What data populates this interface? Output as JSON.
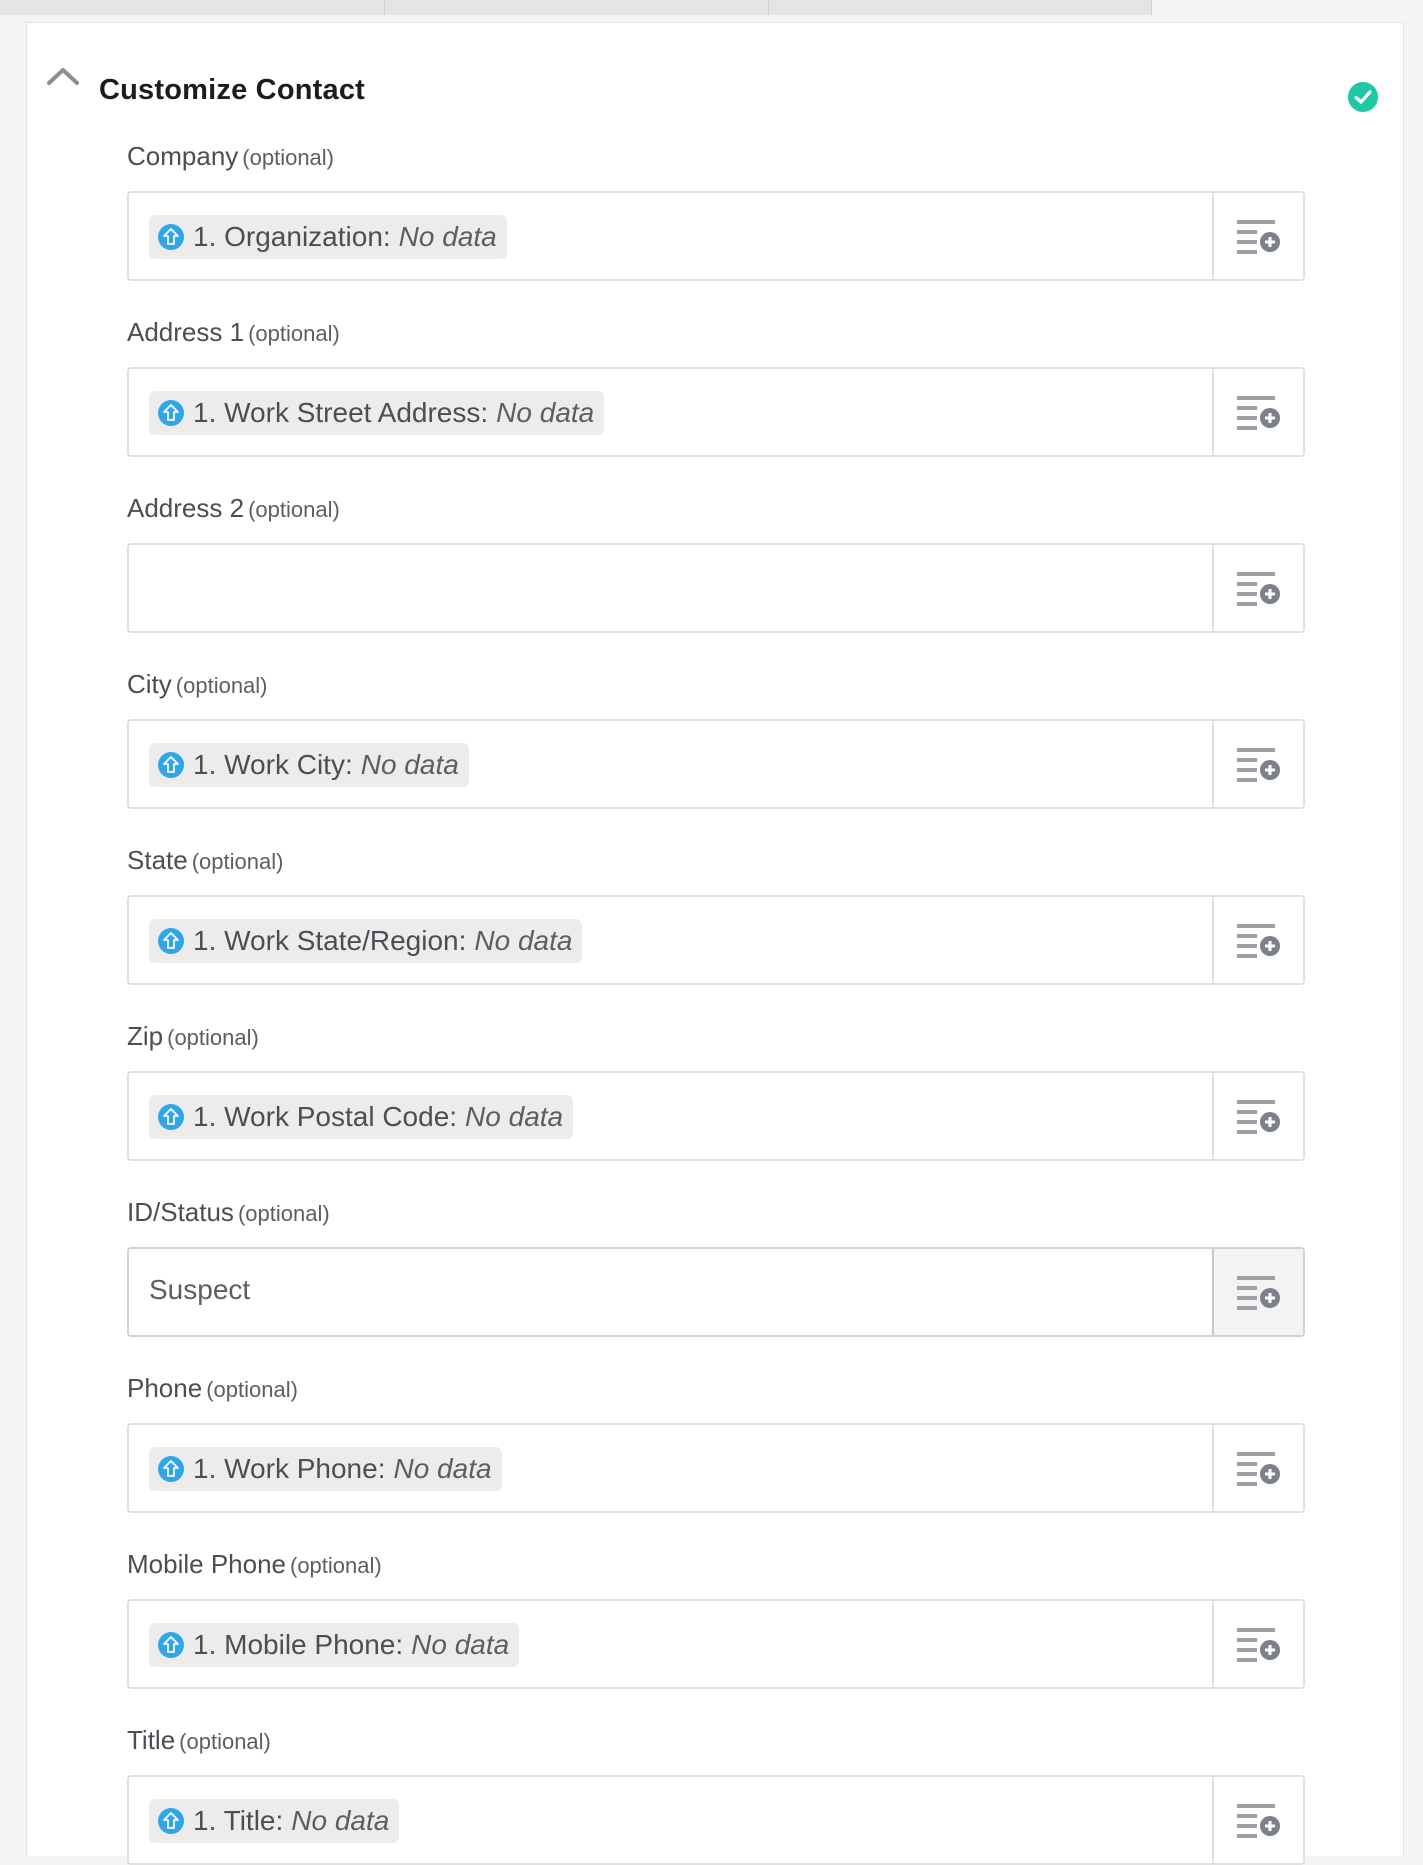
{
  "section": {
    "title": "Customize Contact",
    "status": "complete"
  },
  "colors": {
    "accent_check": "#1fc8a4",
    "pill_icon": "#2ea6e8"
  },
  "optional_marker": "(optional)",
  "fields": [
    {
      "label": "Company",
      "mapped_field": "1. Organization:",
      "mapped_value": "No data"
    },
    {
      "label": "Address 1",
      "mapped_field": "1. Work Street Address:",
      "mapped_value": "No data"
    },
    {
      "label": "Address 2",
      "value": ""
    },
    {
      "label": "City",
      "mapped_field": "1. Work City:",
      "mapped_value": "No data"
    },
    {
      "label": "State",
      "mapped_field": "1. Work State/Region:",
      "mapped_value": "No data"
    },
    {
      "label": "Zip",
      "mapped_field": "1. Work Postal Code:",
      "mapped_value": "No data"
    },
    {
      "label": "ID/Status",
      "value": "Suspect"
    },
    {
      "label": "Phone",
      "mapped_field": "1. Work Phone:",
      "mapped_value": "No data"
    },
    {
      "label": "Mobile Phone",
      "mapped_field": "1. Mobile Phone:",
      "mapped_value": "No data"
    },
    {
      "label": "Title",
      "mapped_field": "1. Title:",
      "mapped_value": "No data"
    }
  ]
}
